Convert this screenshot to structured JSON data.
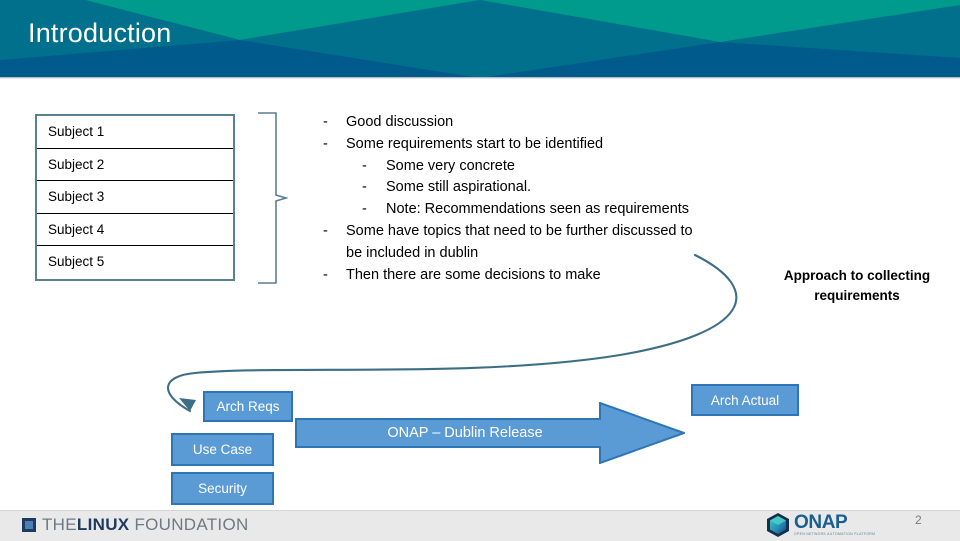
{
  "slide": {
    "title": "Introduction",
    "page_number": "2"
  },
  "colors": {
    "header_teal": "#009B8D",
    "header_mid_blue": "#00708C",
    "header_dark_blue": "#005B8C",
    "box_fill": "#5B9BD5",
    "box_border": "#2E75B6",
    "table_border": "#5b7f94",
    "arrow_stroke": "#3d6e87"
  },
  "subjects": [
    {
      "label": "Subject 1"
    },
    {
      "label": "Subject 2"
    },
    {
      "label": "Subject 3"
    },
    {
      "label": "Subject 4"
    },
    {
      "label": "Subject 5"
    }
  ],
  "bullets": [
    {
      "level": 1,
      "dash": "-",
      "text": "Good discussion"
    },
    {
      "level": 1,
      "dash": "-",
      "text": "Some requirements start to be identified"
    },
    {
      "level": 2,
      "dash": "-",
      "text": "Some very concrete"
    },
    {
      "level": 2,
      "dash": "-",
      "text": "Some still aspirational."
    },
    {
      "level": 2,
      "dash": "-",
      "text": "Note: Recommendations seen as requirements"
    },
    {
      "level": 1,
      "dash": "-",
      "text": "Some have topics that need to be further discussed to be included in dublin",
      "wrap": true
    },
    {
      "level": 1,
      "dash": "-",
      "text": "Then there are some decisions to make"
    }
  ],
  "captions": {
    "approach": "Approach to collecting requirements"
  },
  "boxes": {
    "arch_reqs": "Arch Reqs",
    "use_case": "Use Case",
    "security": "Security",
    "arch_actual": "Arch Actual",
    "release_arrow": "ONAP – Dublin Release"
  },
  "footer": {
    "linux_foundation": {
      "the": "THE",
      "linux": "LINUX",
      "foundation": "FOUNDATION"
    },
    "onap": {
      "name": "ONAP",
      "tagline": "OPEN NETWORK AUTOMATION PLATFORM"
    }
  }
}
